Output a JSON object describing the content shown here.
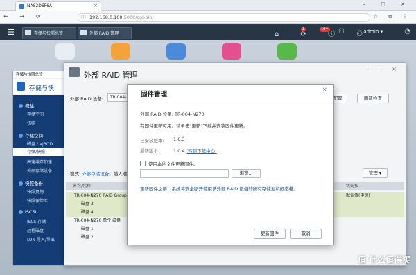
{
  "browser": {
    "tab_title": "NAS2D6F6A",
    "tab_close": "×",
    "window_controls": "– □ ×",
    "nav_buttons": "← → ⟳",
    "url_info_icon": "ⓘ",
    "url_host": "192.168.0.100",
    "url_rest": ":5000/cgi-bin/",
    "toolbar_icons": "☆ ⧉ ⋮"
  },
  "qts": {
    "menu_icon": "☰",
    "app_buttons": [
      "存储与快照总管",
      "外部 RAID 管理"
    ],
    "tray_icons": "⌂ ⟳ ⓘ ⚇",
    "badge_1": "2",
    "badge_2": "10+",
    "user": "admin ▾",
    "gauge_icon": "◔"
  },
  "storage_window": {
    "title": "存储与快照总管",
    "header": "存储与快",
    "nav": [
      {
        "type": "section",
        "label": "概述"
      },
      {
        "type": "item",
        "label": "存储空间"
      },
      {
        "type": "item",
        "label": "快照"
      },
      {
        "type": "section",
        "label": "存储空间"
      },
      {
        "type": "item",
        "label": "磁盘 / VJBOD"
      },
      {
        "type": "item",
        "label": "存储/快照",
        "active": true
      },
      {
        "type": "item",
        "label": "高速缓存加速"
      },
      {
        "type": "item",
        "label": "外部存储设备"
      },
      {
        "type": "section",
        "label": "快照备份"
      },
      {
        "type": "item",
        "label": "快照复制"
      },
      {
        "type": "item",
        "label": "快照保险库"
      },
      {
        "type": "section",
        "label": "iSCSI"
      },
      {
        "type": "item",
        "label": "iSCSI存储"
      },
      {
        "type": "item",
        "label": "远程磁盘"
      },
      {
        "type": "item",
        "label": "LUN 导入/导出"
      }
    ]
  },
  "raid_window": {
    "title": "外部 RAID 管理",
    "window_controls": "– + ×",
    "device_label": "外部 RAID 设备:",
    "device_value": "TR-004-N27",
    "config_button": "配置",
    "refresh_button": "刷新检查",
    "mode_prefix": "模式:",
    "mode_link": "外部存储设备",
    "mode_suffix": "。插入磁盘",
    "manage_button": "管理 ▾",
    "table_header_name": "名称/代称",
    "table_header_priority": "优先权",
    "rows": [
      {
        "name": "TR-004-N270 RAID Group",
        "extra": "默认值(中速)",
        "highlight": true,
        "indent": false
      },
      {
        "name": "磁盘 3",
        "extra": "",
        "highlight": true,
        "indent": true
      },
      {
        "name": "磁盘 4",
        "extra": "",
        "highlight": true,
        "indent": true
      },
      {
        "name": "TR-004-N270 单个 磁盘",
        "extra": "",
        "highlight": false,
        "indent": false
      },
      {
        "name": "磁盘 1",
        "extra": "",
        "highlight": false,
        "indent": true
      },
      {
        "name": "磁盘 2",
        "extra": "",
        "highlight": false,
        "indent": true
      }
    ]
  },
  "firmware_dialog": {
    "title": "固件管理",
    "close": "×",
    "device_line": "外部 RAID 设备:  TR-004-N270",
    "update_available": "有固件更新可用。请单击\"更新\"下载并安装固件更新。",
    "installed_label": "已安装版本:",
    "installed_value": "1.0.3",
    "latest_label": "最新版本:",
    "latest_value": "1.0.4",
    "latest_link": "(转到下载中心)",
    "local_file_label": "使用本地文件更新固件。",
    "browse_button": "浏览...",
    "note": "更新固件之前，系统将安全断开使用该外部 RAID 设备的所有存储池和静态卷。",
    "update_button": "更新固件",
    "cancel_button": "取消"
  },
  "watermark": "值 什么值得买"
}
